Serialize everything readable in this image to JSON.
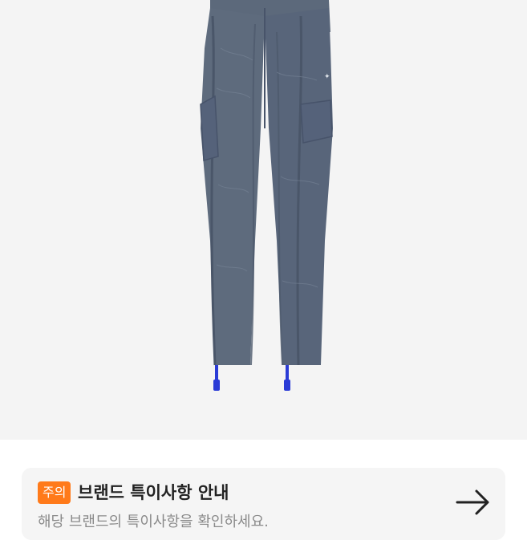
{
  "product": {
    "image_alt": "Gray cargo pants",
    "colors": {
      "background": "#f4f4f4",
      "fabric": "#5e6b7d",
      "fabric_dark": "#48546a",
      "zip_accent": "#2a3bd6"
    }
  },
  "notice": {
    "badge_label": "주의",
    "title": "브랜드 특이사항 안내",
    "subtitle": "해당 브랜드의 특이사항을 확인하세요.",
    "arrow_icon": "arrow-right-icon",
    "badge_color": "#ff7a1a"
  }
}
